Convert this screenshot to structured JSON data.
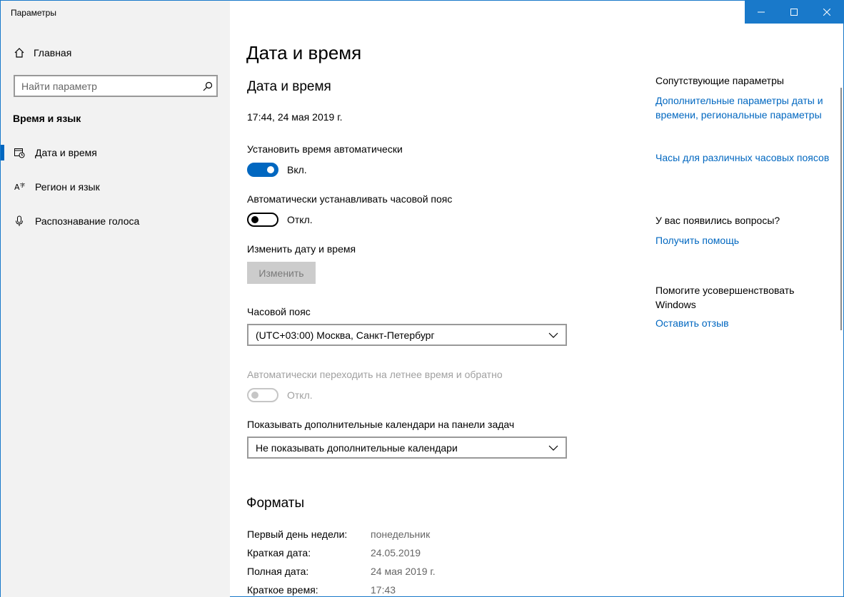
{
  "window": {
    "title": "Параметры",
    "controls": {
      "minimize": "—",
      "maximize": "☐",
      "close": "✕"
    }
  },
  "sidebar": {
    "home_label": "Главная",
    "search_placeholder": "Найти параметр",
    "section_title": "Время и язык",
    "items": [
      {
        "label": "Дата и время",
        "icon": "calendar-clock-icon",
        "active": true
      },
      {
        "label": "Регион и язык",
        "icon": "language-icon",
        "active": false
      },
      {
        "label": "Распознавание голоса",
        "icon": "microphone-icon",
        "active": false
      }
    ]
  },
  "main": {
    "page_title": "Дата и время",
    "sub_title": "Дата и время",
    "current_datetime": "17:44, 24 мая 2019 г.",
    "auto_time": {
      "label": "Установить время автоматически",
      "state": "Вкл."
    },
    "auto_timezone": {
      "label": "Автоматически устанавливать часовой пояс",
      "state": "Откл."
    },
    "change_datetime": {
      "label": "Изменить дату и время",
      "button": "Изменить"
    },
    "timezone": {
      "label": "Часовой пояс",
      "value": "(UTC+03:00) Москва, Санкт-Петербург"
    },
    "dst": {
      "label": "Автоматически переходить на летнее время и обратно",
      "state": "Откл."
    },
    "calendars": {
      "label": "Показывать дополнительные календари на панели задач",
      "value": "Не показывать дополнительные календари"
    },
    "formats": {
      "title": "Форматы",
      "rows": [
        {
          "key": "Первый день недели:",
          "value": "понедельник"
        },
        {
          "key": "Краткая дата:",
          "value": "24.05.2019"
        },
        {
          "key": "Полная дата:",
          "value": "24 мая 2019 г."
        },
        {
          "key": "Краткое время:",
          "value": "17:43"
        }
      ]
    }
  },
  "related": {
    "heading": "Сопутствующие параметры",
    "link_additional": "Дополнительные параметры даты и времени, региональные параметры",
    "link_clocks": "Часы для различных часовых поясов",
    "questions_heading": "У вас появились вопросы?",
    "link_help": "Получить помощь",
    "improve_heading": "Помогите усовершенствовать Windows",
    "link_feedback": "Оставить отзыв"
  },
  "colors": {
    "accent": "#0067c0",
    "titlebar": "#1979ca",
    "sidebar_bg": "#f2f2f2"
  }
}
